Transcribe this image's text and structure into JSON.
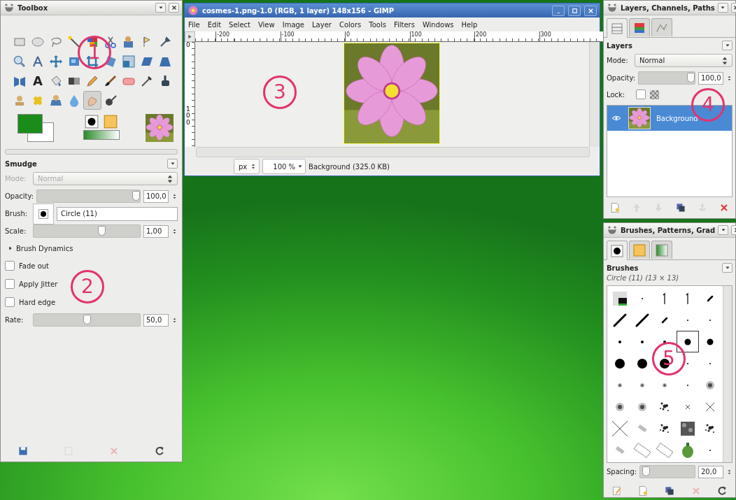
{
  "toolbox": {
    "title": "Toolbox",
    "tools": [
      {
        "kind": "rect-select",
        "selected": false
      },
      {
        "kind": "ellipse-select",
        "selected": false
      },
      {
        "kind": "lasso",
        "selected": false
      },
      {
        "kind": "wand",
        "selected": false
      },
      {
        "kind": "color-select",
        "selected": false
      },
      {
        "kind": "scissors",
        "selected": false
      },
      {
        "kind": "foreground-select",
        "selected": false
      },
      {
        "kind": "paths",
        "selected": false
      },
      {
        "kind": "color-picker",
        "selected": false
      },
      {
        "kind": "zoom",
        "selected": false
      },
      {
        "kind": "measure",
        "selected": false
      },
      {
        "kind": "move",
        "selected": false
      },
      {
        "kind": "align",
        "selected": false
      },
      {
        "kind": "crop",
        "selected": false
      },
      {
        "kind": "rotate",
        "selected": false
      },
      {
        "kind": "scale",
        "selected": false
      },
      {
        "kind": "shear",
        "selected": false
      },
      {
        "kind": "perspective",
        "selected": false
      },
      {
        "kind": "flip",
        "selected": false
      },
      {
        "kind": "text",
        "glyph": "A",
        "selected": false
      },
      {
        "kind": "bucket",
        "selected": false
      },
      {
        "kind": "blend",
        "selected": false
      },
      {
        "kind": "pencil",
        "selected": false
      },
      {
        "kind": "brush",
        "selected": false
      },
      {
        "kind": "eraser",
        "selected": false
      },
      {
        "kind": "airbrush",
        "selected": false
      },
      {
        "kind": "ink",
        "selected": false
      },
      {
        "kind": "clone",
        "selected": false
      },
      {
        "kind": "heal",
        "selected": false
      },
      {
        "kind": "perspective-clone",
        "selected": false
      },
      {
        "kind": "blur",
        "selected": false
      },
      {
        "kind": "smudge",
        "selected": true
      },
      {
        "kind": "dodge",
        "selected": false
      }
    ],
    "colors": [
      {
        "kind": "foreground",
        "color": "#1a8c1a"
      },
      {
        "kind": "background",
        "color": "#ffffff"
      }
    ]
  },
  "tool_options": {
    "title": "Smudge",
    "mode": {
      "label": "Mode:",
      "value": "Normal",
      "disabled": true
    },
    "opacity": {
      "label": "Opacity:",
      "value": "100,0",
      "level": 1
    },
    "brush": {
      "label": "Brush:",
      "value": "Circle (11)"
    },
    "scale": {
      "label": "Scale:",
      "value": "1,00",
      "level": 0.65
    },
    "expander": {
      "label": "Brush Dynamics",
      "expanded": false
    },
    "options": [
      {
        "label": "Fade out",
        "checked": false
      },
      {
        "label": "Apply Jitter",
        "checked": false
      },
      {
        "label": "Hard edge",
        "checked": false
      }
    ],
    "rate": {
      "label": "Rate:",
      "value": "50,0",
      "level": 0.5
    },
    "buttons": [
      {
        "kind": "save",
        "disabled": false
      },
      {
        "kind": "restore",
        "disabled": true
      },
      {
        "kind": "delete",
        "disabled": true
      },
      {
        "kind": "reset",
        "disabled": false
      }
    ]
  },
  "image_window": {
    "title": "cosmes-1.png-1.0 (RGB, 1 layer) 148x156 - GIMP",
    "menu": [
      "File",
      "Edit",
      "Select",
      "View",
      "Image",
      "Layer",
      "Colors",
      "Tools",
      "Filters",
      "Windows",
      "Help"
    ],
    "ruler_marks": [
      "-200",
      "-100",
      "0",
      "100",
      "200",
      "300"
    ],
    "vertical_ruler_marks": [
      "0",
      "100"
    ],
    "status": {
      "unit": "px",
      "zoom": "100 %",
      "info": "Background (325.0 KB)"
    }
  },
  "layers_panel": {
    "title": "Layers, Channels, Paths",
    "tabs": [
      {
        "kind": "layers",
        "selected": true
      },
      {
        "kind": "channels",
        "selected": false
      },
      {
        "kind": "paths",
        "selected": false
      }
    ],
    "heading": "Layers",
    "mode": {
      "label": "Mode:",
      "value": "Normal"
    },
    "opacity": {
      "label": "Opacity:",
      "value": "100,0",
      "level": 1
    },
    "lock": {
      "label": "Lock:",
      "checked": false
    },
    "layers": [
      {
        "name": "Background",
        "visible": true,
        "selected": true
      }
    ],
    "buttons": [
      {
        "kind": "new",
        "disabled": false
      },
      {
        "kind": "raise",
        "disabled": true
      },
      {
        "kind": "lower",
        "disabled": true
      },
      {
        "kind": "duplicate",
        "disabled": false
      },
      {
        "kind": "anchor",
        "disabled": true
      },
      {
        "kind": "delete",
        "disabled": false
      }
    ]
  },
  "brushes_panel": {
    "title": "Brushes, Patterns, Grad",
    "tabs": [
      {
        "kind": "brushes",
        "selected": true
      },
      {
        "kind": "patterns",
        "selected": false
      },
      {
        "kind": "gradients",
        "selected": false
      }
    ],
    "heading": "Brushes",
    "brush_info": "Circle (11) (13 × 13)",
    "brushes": [
      {
        "kind": "image",
        "selected": false
      },
      {
        "kind": "speck",
        "selected": false
      },
      {
        "kind": "one",
        "selected": false
      },
      {
        "kind": "one",
        "selected": false
      },
      {
        "kind": "stroke-s",
        "selected": false
      },
      {
        "kind": "stroke-l",
        "selected": false
      },
      {
        "kind": "stroke-l",
        "selected": false
      },
      {
        "kind": "stroke-s",
        "selected": false
      },
      {
        "kind": "speck",
        "selected": false
      },
      {
        "kind": "speck",
        "selected": false
      },
      {
        "kind": "dot-s",
        "selected": false
      },
      {
        "kind": "dot-s",
        "selected": false
      },
      {
        "kind": "dot-s",
        "selected": false
      },
      {
        "kind": "dot-m",
        "selected": true
      },
      {
        "kind": "dot-m",
        "selected": false
      },
      {
        "kind": "dot-l",
        "selected": false
      },
      {
        "kind": "dot-l",
        "selected": false
      },
      {
        "kind": "dot-l",
        "selected": false
      },
      {
        "kind": "speck",
        "selected": false
      },
      {
        "kind": "speck",
        "selected": false
      },
      {
        "kind": "fuzzy-s",
        "selected": false
      },
      {
        "kind": "fuzzy-s",
        "selected": false
      },
      {
        "kind": "fuzzy-s",
        "selected": false
      },
      {
        "kind": "speck",
        "selected": false
      },
      {
        "kind": "fuzzy-m",
        "selected": false
      },
      {
        "kind": "fuzzy-m",
        "selected": false
      },
      {
        "kind": "fuzzy-m",
        "selected": false
      },
      {
        "kind": "splatter",
        "selected": false
      },
      {
        "kind": "cross-s",
        "selected": false
      },
      {
        "kind": "cross-m",
        "selected": false
      },
      {
        "kind": "cross-l",
        "selected": false
      },
      {
        "kind": "chalk",
        "selected": false
      },
      {
        "kind": "splatter",
        "selected": false
      },
      {
        "kind": "texture",
        "selected": false
      },
      {
        "kind": "splatter",
        "selected": false
      },
      {
        "kind": "chalk",
        "selected": false
      },
      {
        "kind": "grid",
        "selected": false
      },
      {
        "kind": "grid",
        "selected": false
      },
      {
        "kind": "pepper",
        "selected": false
      },
      {
        "kind": "speck",
        "selected": false
      }
    ],
    "spacing": {
      "label": "Spacing:",
      "value": "20,0",
      "level": 0.05
    },
    "buttons": [
      {
        "kind": "edit",
        "disabled": false
      },
      {
        "kind": "new",
        "disabled": false
      },
      {
        "kind": "duplicate",
        "disabled": false
      },
      {
        "kind": "delete",
        "disabled": true
      },
      {
        "kind": "reset",
        "disabled": false
      }
    ]
  },
  "callouts": [
    "1",
    "2",
    "3",
    "4",
    "5"
  ]
}
